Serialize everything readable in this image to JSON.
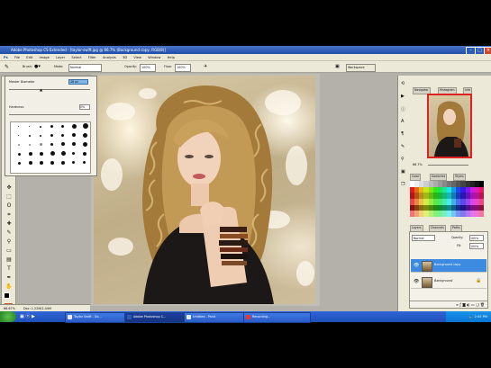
{
  "window": {
    "title": "Adobe Photoshop CS Extended - [taylor-swift.jpg @ 66.7% (Background copy, RGB/8)]"
  },
  "menu": [
    "File",
    "Edit",
    "Image",
    "Layer",
    "Select",
    "Filter",
    "Analysis",
    "3D",
    "View",
    "Window",
    "Help"
  ],
  "options": {
    "brush_label": "Brush:",
    "mode_label": "Mode:",
    "mode_value": "Normal",
    "opacity_label": "Opacity:",
    "opacity_value": "100%",
    "flow_label": "Flow:",
    "flow_value": "100%",
    "workspace_label": "Workspace"
  },
  "brush_panel": {
    "master_diameter": "Master Diameter",
    "diameter_value": "48 px",
    "hardness": "Hardness:",
    "hardness_value": "0%"
  },
  "right_dock": {
    "navigator_tab": "Navigator",
    "histogram_tab": "Histogram",
    "info_tab": "Info",
    "zoom_value": "66.7%",
    "color_tab": "Color",
    "swatches_tab": "Swatches",
    "styles_tab": "Styles",
    "layers_tab": "Layers",
    "channels_tab": "Channels",
    "paths_tab": "Paths",
    "blend_mode": "Normal",
    "opacity_label": "Opacity:",
    "opacity_value": "100%",
    "fill_label": "Fill:",
    "fill_value": "100%",
    "layers": [
      {
        "name": "Background copy",
        "selected": true
      },
      {
        "name": "Background",
        "selected": false
      }
    ]
  },
  "status": {
    "zoom": "66.67%",
    "doc": "Doc: 1.22M/2.44M"
  },
  "taskbar": {
    "tasks": [
      {
        "label": "Taylor Swift - Go..."
      },
      {
        "label": "Adobe Photoshop C..."
      },
      {
        "label": "Untitled - Paint"
      },
      {
        "label": "Recording..."
      }
    ],
    "clock": "2:45 PM"
  },
  "icons": {
    "start": "windows-start-icon",
    "eye": "eye-icon",
    "brush": "brush-icon"
  },
  "colors": {
    "accent": "#2f65d8",
    "selected_layer": "#3d8be0",
    "titlebar": "#1f4fa9"
  }
}
